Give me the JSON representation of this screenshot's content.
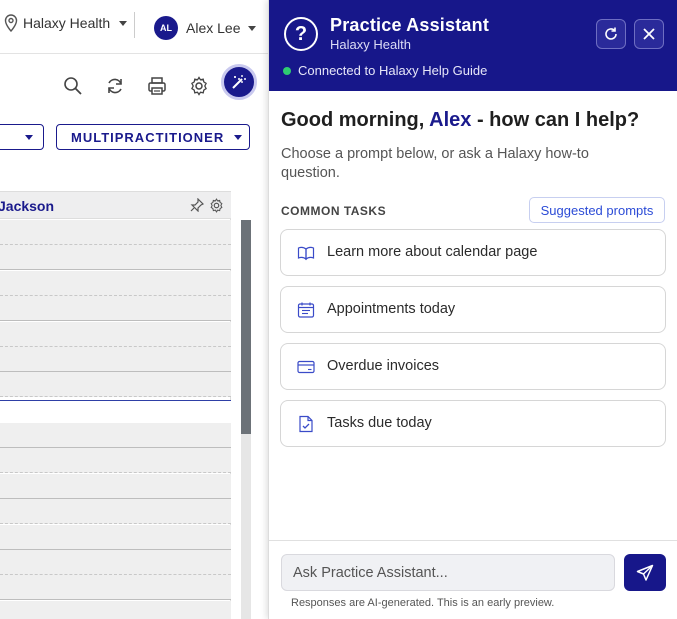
{
  "background_app": {
    "location": {
      "label": "Halaxy Health",
      "icon": "map-pin-icon"
    },
    "user": {
      "initials": "AL",
      "name": "Alex Lee"
    },
    "toolbar": {
      "icons": [
        "search-icon",
        "refresh-icon",
        "print-icon",
        "settings-icon",
        "magic-wand-icon"
      ]
    },
    "dropdowns": {
      "multipractitioner_label": "MULTIPRACTITIONER"
    },
    "calendar": {
      "column_name": "Jackson"
    }
  },
  "assistant": {
    "title": "Practice Assistant",
    "subtitle": "Halaxy Health",
    "status": "Connected to Halaxy Help Guide",
    "greeting": {
      "prefix": "Good morning,",
      "name": "Alex",
      "suffix": "- how can I help?"
    },
    "intro": "Choose a prompt below, or ask a Halaxy how-to question.",
    "common_tasks_label": "COMMON TASKS",
    "suggested_prompts_label": "Suggested prompts",
    "tasks": [
      {
        "label": "Learn more about calendar page",
        "icon": "book-icon"
      },
      {
        "label": "Appointments today",
        "icon": "calendar-icon"
      },
      {
        "label": "Overdue invoices",
        "icon": "credit-card-icon"
      },
      {
        "label": "Tasks due today",
        "icon": "task-document-icon"
      }
    ],
    "input": {
      "placeholder": "Ask Practice Assistant..."
    },
    "disclaimer": "Responses are AI-generated. This is an early preview."
  },
  "colors": {
    "brand_navy": "#17178a",
    "link_blue": "#2b4bd6",
    "status_green": "#2ecc71"
  }
}
